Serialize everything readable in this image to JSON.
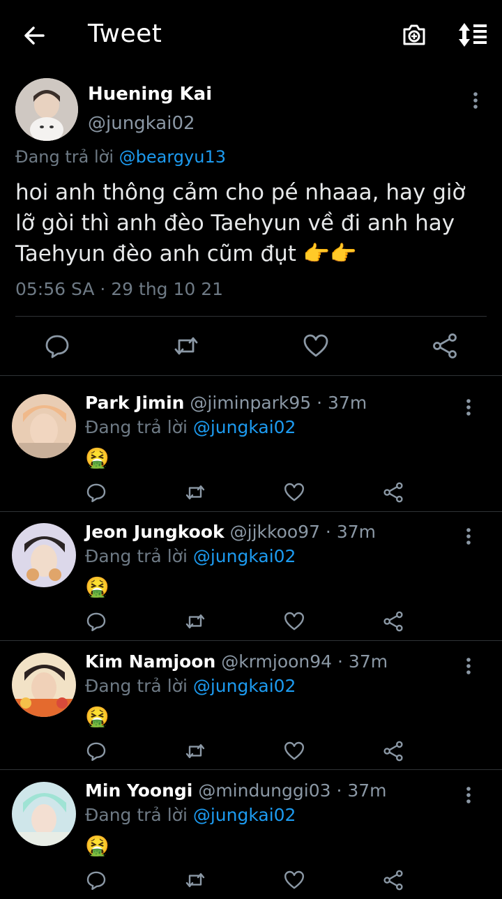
{
  "header": {
    "title": "Tweet"
  },
  "main_tweet": {
    "name": "Huening Kai",
    "handle": "@jungkai02",
    "replying_prefix": "Đang trả lời",
    "replying_to": "@beargyu13",
    "text": "hoi anh thông cảm cho pé nhaaa, hay giờ lỡ gòi thì anh đèo Taehyun về đi anh hay Taehyun đèo anh cũm đụt 👉👉",
    "timestamp": "05:56 SA · 29 thg 10 21"
  },
  "replies": [
    {
      "name": "Park Jimin",
      "handle": "@jiminpark95 · 37m",
      "replying_prefix": "Đang trả lời",
      "replying_to": "@jungkai02",
      "emoji": "🤮",
      "avatar_color": "#e8c7a8"
    },
    {
      "name": "Jeon Jungkook",
      "handle": "@jjkkoo97 · 37m",
      "replying_prefix": "Đang trả lời",
      "replying_to": "@jungkai02",
      "emoji": "🤮",
      "avatar_color": "#d8d4e6"
    },
    {
      "name": "Kim Namjoon",
      "handle": "@krmjoon94 · 37m",
      "replying_prefix": "Đang trả lời",
      "replying_to": "@jungkai02",
      "emoji": "🤮",
      "avatar_color": "#e07a3a"
    },
    {
      "name": "Min Yoongi",
      "handle": "@mindunggi03 · 37m",
      "replying_prefix": "Đang trả lời",
      "replying_to": "@jungkai02",
      "emoji": "🤮",
      "avatar_color": "#b8d8e0"
    }
  ],
  "icons": {
    "back": "arrow-left-icon",
    "camera": "camera-icon",
    "sort": "sort-icon",
    "more": "more-vertical-icon",
    "reply": "reply-icon",
    "retweet": "retweet-icon",
    "like": "heart-icon",
    "share": "share-icon"
  },
  "colors": {
    "background": "#000000",
    "accent": "#1d9bf0",
    "muted": "#6e7a85",
    "divider": "#2f3336"
  }
}
